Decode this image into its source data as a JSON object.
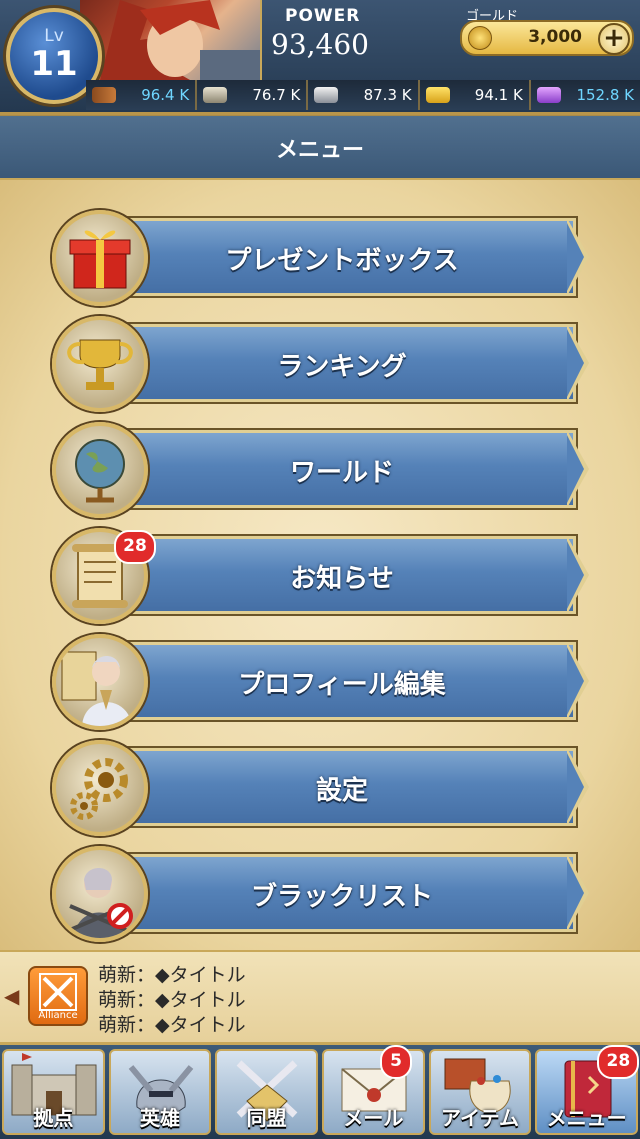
{
  "header": {
    "level_prefix": "Lv",
    "level": "11",
    "power_label": "POWER",
    "power_value": "93,460",
    "gold_label": "ゴールド",
    "gold_value": "3,000",
    "gold_add": "+",
    "resources": [
      {
        "icon": "wood-icon",
        "value": "96.4 K",
        "color": "#6fd6ff"
      },
      {
        "icon": "stone-icon",
        "value": "76.7 K",
        "color": "#ffffff"
      },
      {
        "icon": "iron-icon",
        "value": "87.3 K",
        "color": "#ffffff"
      },
      {
        "icon": "grain-icon",
        "value": "94.1 K",
        "color": "#ffffff"
      },
      {
        "icon": "crystal-icon",
        "value": "152.8 K",
        "color": "#6fd6ff"
      }
    ]
  },
  "title": "メニュー",
  "menu": {
    "items": [
      {
        "label": "プレゼントボックス",
        "icon": "gift-box-icon"
      },
      {
        "label": "ランキング",
        "icon": "trophy-icon"
      },
      {
        "label": "ワールド",
        "icon": "globe-icon"
      },
      {
        "label": "お知らせ",
        "icon": "scroll-icon",
        "badge": "28"
      },
      {
        "label": "プロフィール編集",
        "icon": "profile-icon"
      },
      {
        "label": "設定",
        "icon": "gear-icon"
      },
      {
        "label": "ブラックリスト",
        "icon": "blacklist-icon"
      }
    ]
  },
  "news": {
    "alliance_label": "Alliance",
    "lines": [
      "萌新：◆タイトル",
      "萌新：◆タイトル",
      "萌新：◆タイトル"
    ]
  },
  "nav": {
    "items": [
      {
        "label": "拠点",
        "icon": "castle-icon"
      },
      {
        "label": "英雄",
        "icon": "hero-helmet-icon"
      },
      {
        "label": "同盟",
        "icon": "crossed-swords-icon"
      },
      {
        "label": "メール",
        "icon": "mail-icon",
        "badge": "5"
      },
      {
        "label": "アイテム",
        "icon": "item-bag-icon"
      },
      {
        "label": "メニュー",
        "icon": "menu-book-icon",
        "badge": "28"
      }
    ]
  },
  "colors": {
    "accent_gold": "#d8b868",
    "button_blue": "#5582b8",
    "badge_red": "#e12b2b"
  }
}
